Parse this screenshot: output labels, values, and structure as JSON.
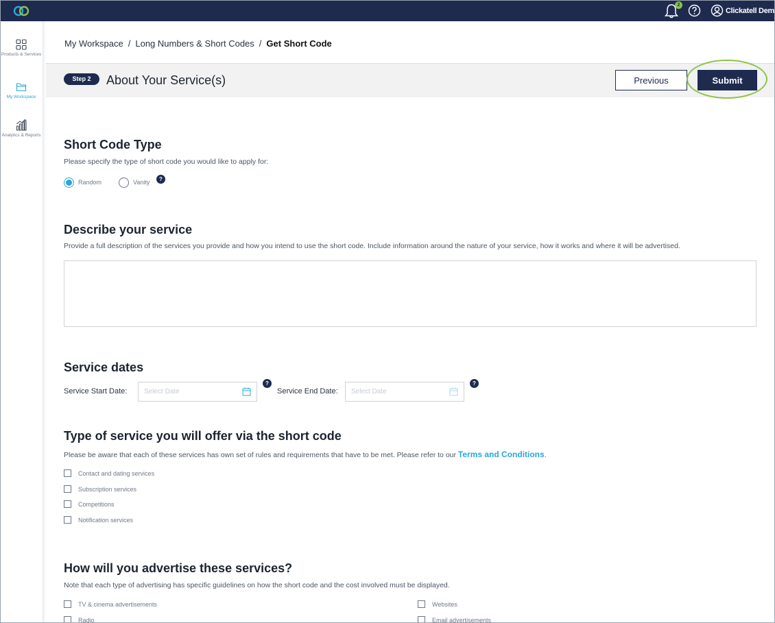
{
  "topbar": {
    "notification_count": "2",
    "user_name": "Clickatell Demo"
  },
  "sidebar": {
    "items": [
      {
        "label": "Products & Services",
        "icon": "grid-icon"
      },
      {
        "label": "My Workspace",
        "icon": "folder-icon",
        "active": true
      },
      {
        "label": "Analytics & Reports",
        "icon": "chart-icon"
      }
    ]
  },
  "breadcrumb": {
    "items": [
      "My Workspace",
      "Long Numbers & Short Codes"
    ],
    "current": "Get Short Code"
  },
  "step": {
    "badge": "Step 2",
    "title": "About Your Service(s)",
    "previous_label": "Previous",
    "submit_label": "Submit"
  },
  "short_code_type": {
    "heading": "Short Code Type",
    "description": "Please specify the type of short code you would like to apply for:",
    "options": [
      {
        "label": "Random",
        "selected": true
      },
      {
        "label": "Vanity",
        "selected": false
      }
    ]
  },
  "describe": {
    "heading": "Describe your service",
    "description": "Provide a full description of the services you provide and how you intend to use the short code. Include information around the nature of your service, how it works and where it will be advertised.",
    "value": ""
  },
  "service_dates": {
    "heading": "Service dates",
    "start_label": "Service Start Date:",
    "end_label": "Service End Date:",
    "placeholder": "Select Date"
  },
  "service_type": {
    "heading": "Type of service you will offer via the short code",
    "description": "Please be aware that each of these services has own set of rules and requirements that have to be met. Please refer to our ",
    "link": "Terms and Conditions",
    "period": ".",
    "options": [
      "Contact and dating services",
      "Subscription services",
      "Competitions",
      "Notification services"
    ]
  },
  "advertise": {
    "heading": "How will you advertise these services?",
    "description": "Note that each type of advertising has specific guidelines on how the short code and the cost involved must be displayed.",
    "options_left": [
      "TV & cinema advertisements",
      "Radio"
    ],
    "options_right": [
      "Websites",
      "Email advertisements"
    ]
  },
  "colors": {
    "topbar": "#1e2b4f",
    "accent": "#2aa7d9",
    "highlight": "#8bc34a"
  }
}
